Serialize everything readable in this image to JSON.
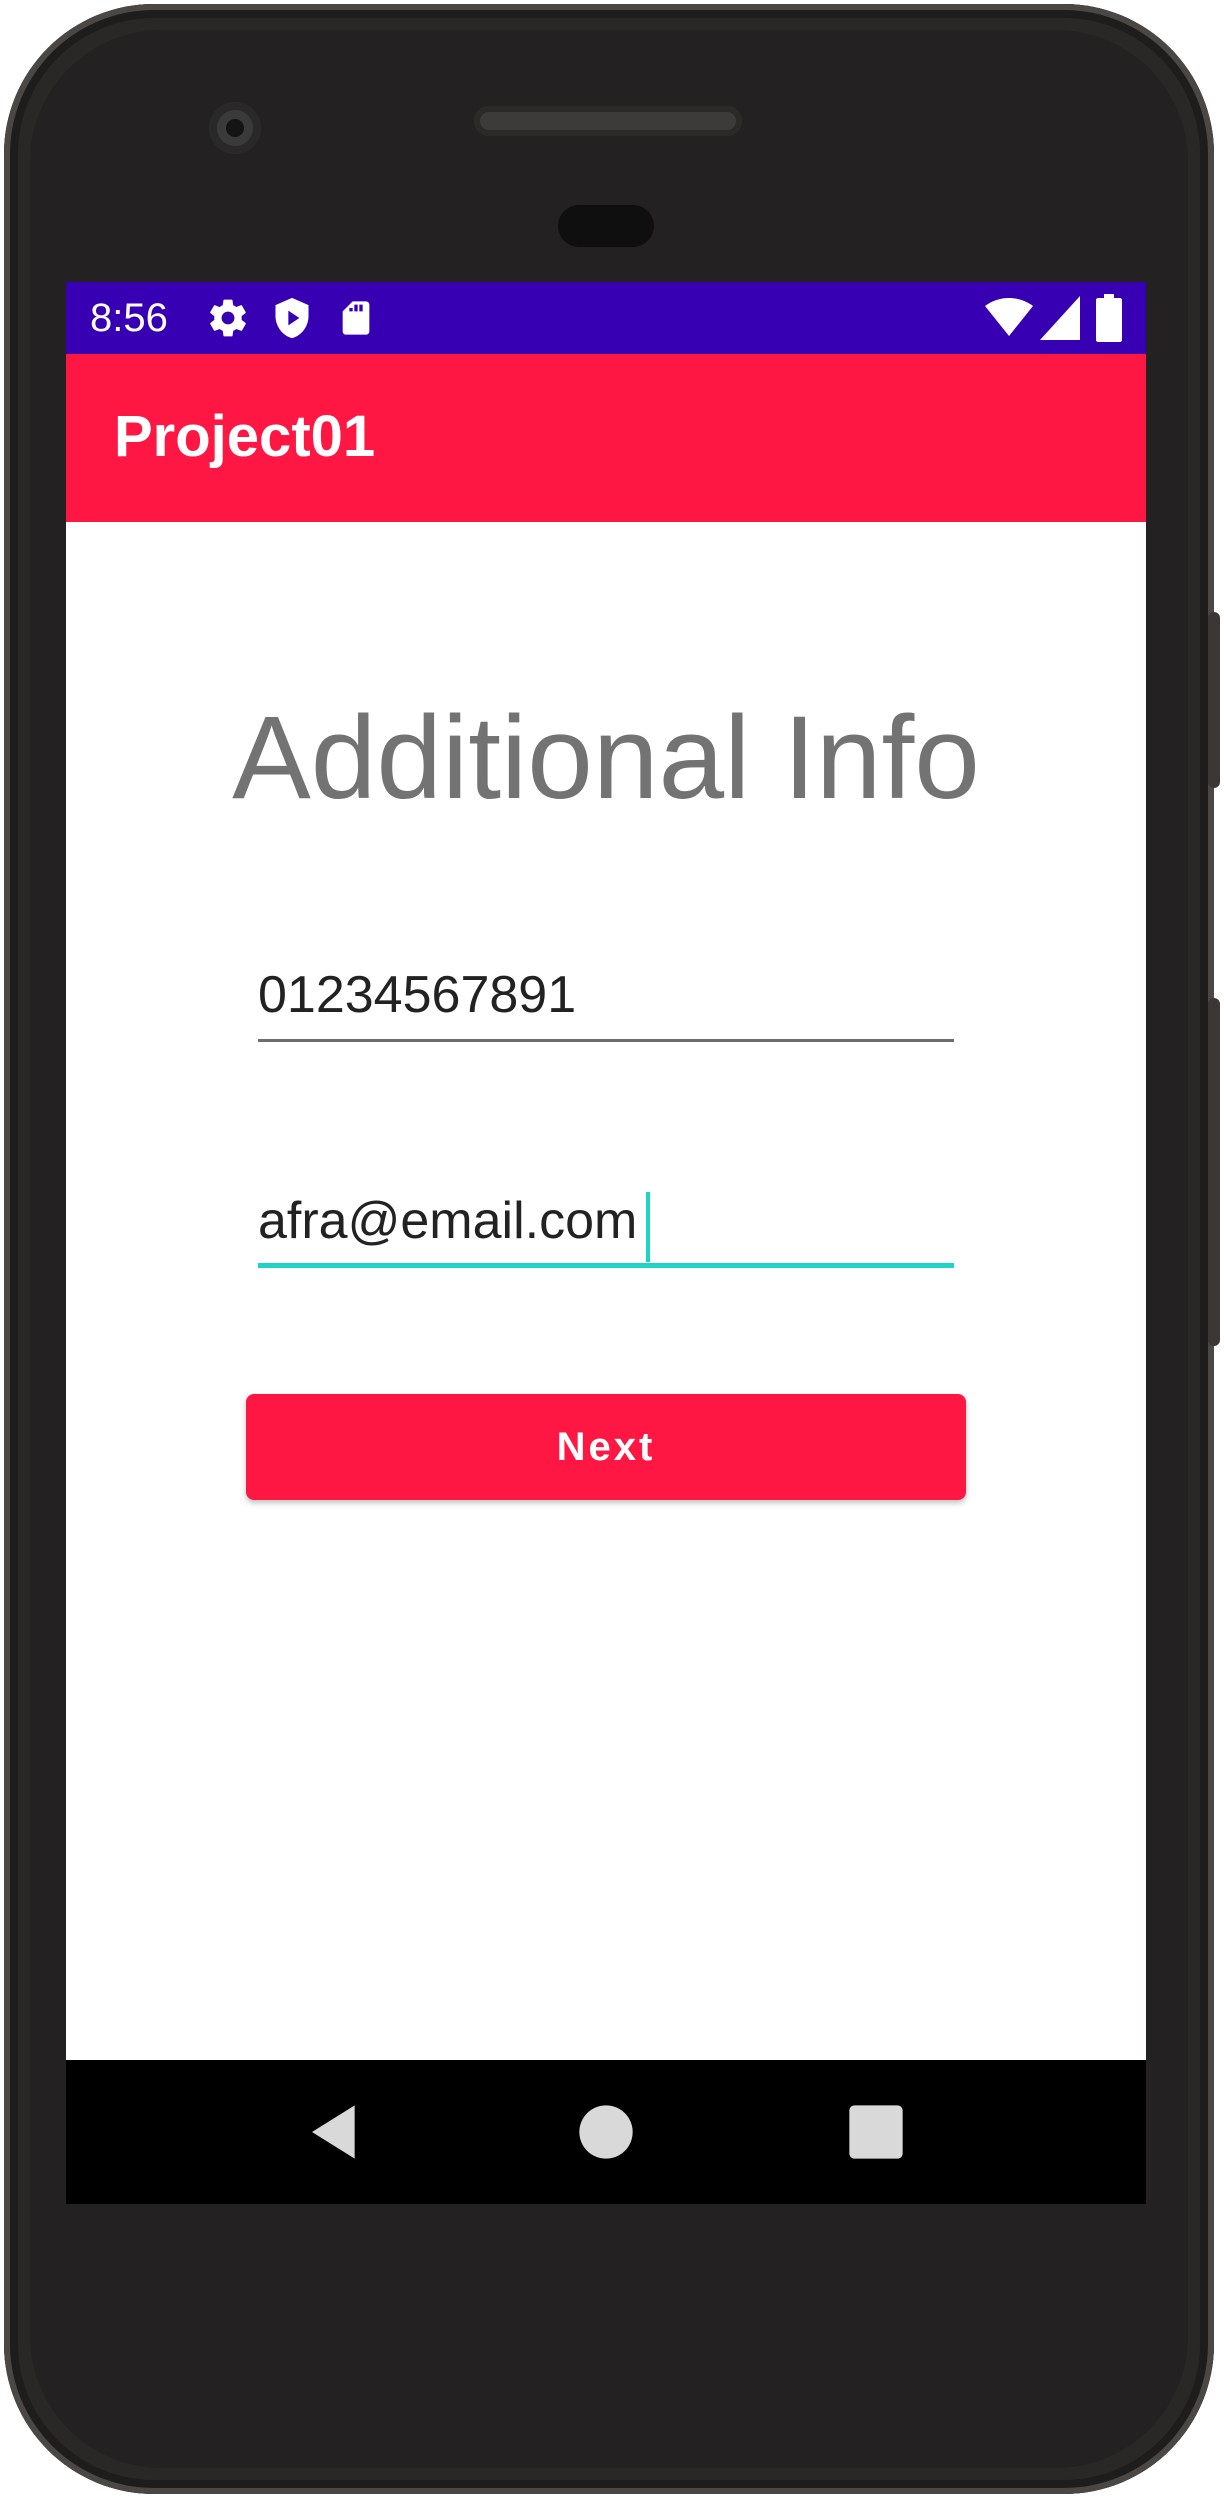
{
  "status_bar": {
    "time": "8:56",
    "left_icons": [
      "gear-icon",
      "shield-play-icon",
      "sd-card-icon"
    ],
    "right_icons": [
      "wifi-icon",
      "signal-icon",
      "battery-icon"
    ],
    "color": "#3700b3"
  },
  "app_bar": {
    "title": "Project01",
    "color": "#ff1744"
  },
  "main": {
    "heading": "Additional Info",
    "phone_field": {
      "value": "01234567891"
    },
    "email_field": {
      "value": "afra@email.com",
      "focused": true,
      "accent_color": "#1fd3c6"
    },
    "next_button": {
      "label": "Next",
      "color": "#ff1744"
    }
  },
  "nav_bar": {
    "buttons": [
      "back-icon",
      "home-icon",
      "recents-icon"
    ]
  }
}
